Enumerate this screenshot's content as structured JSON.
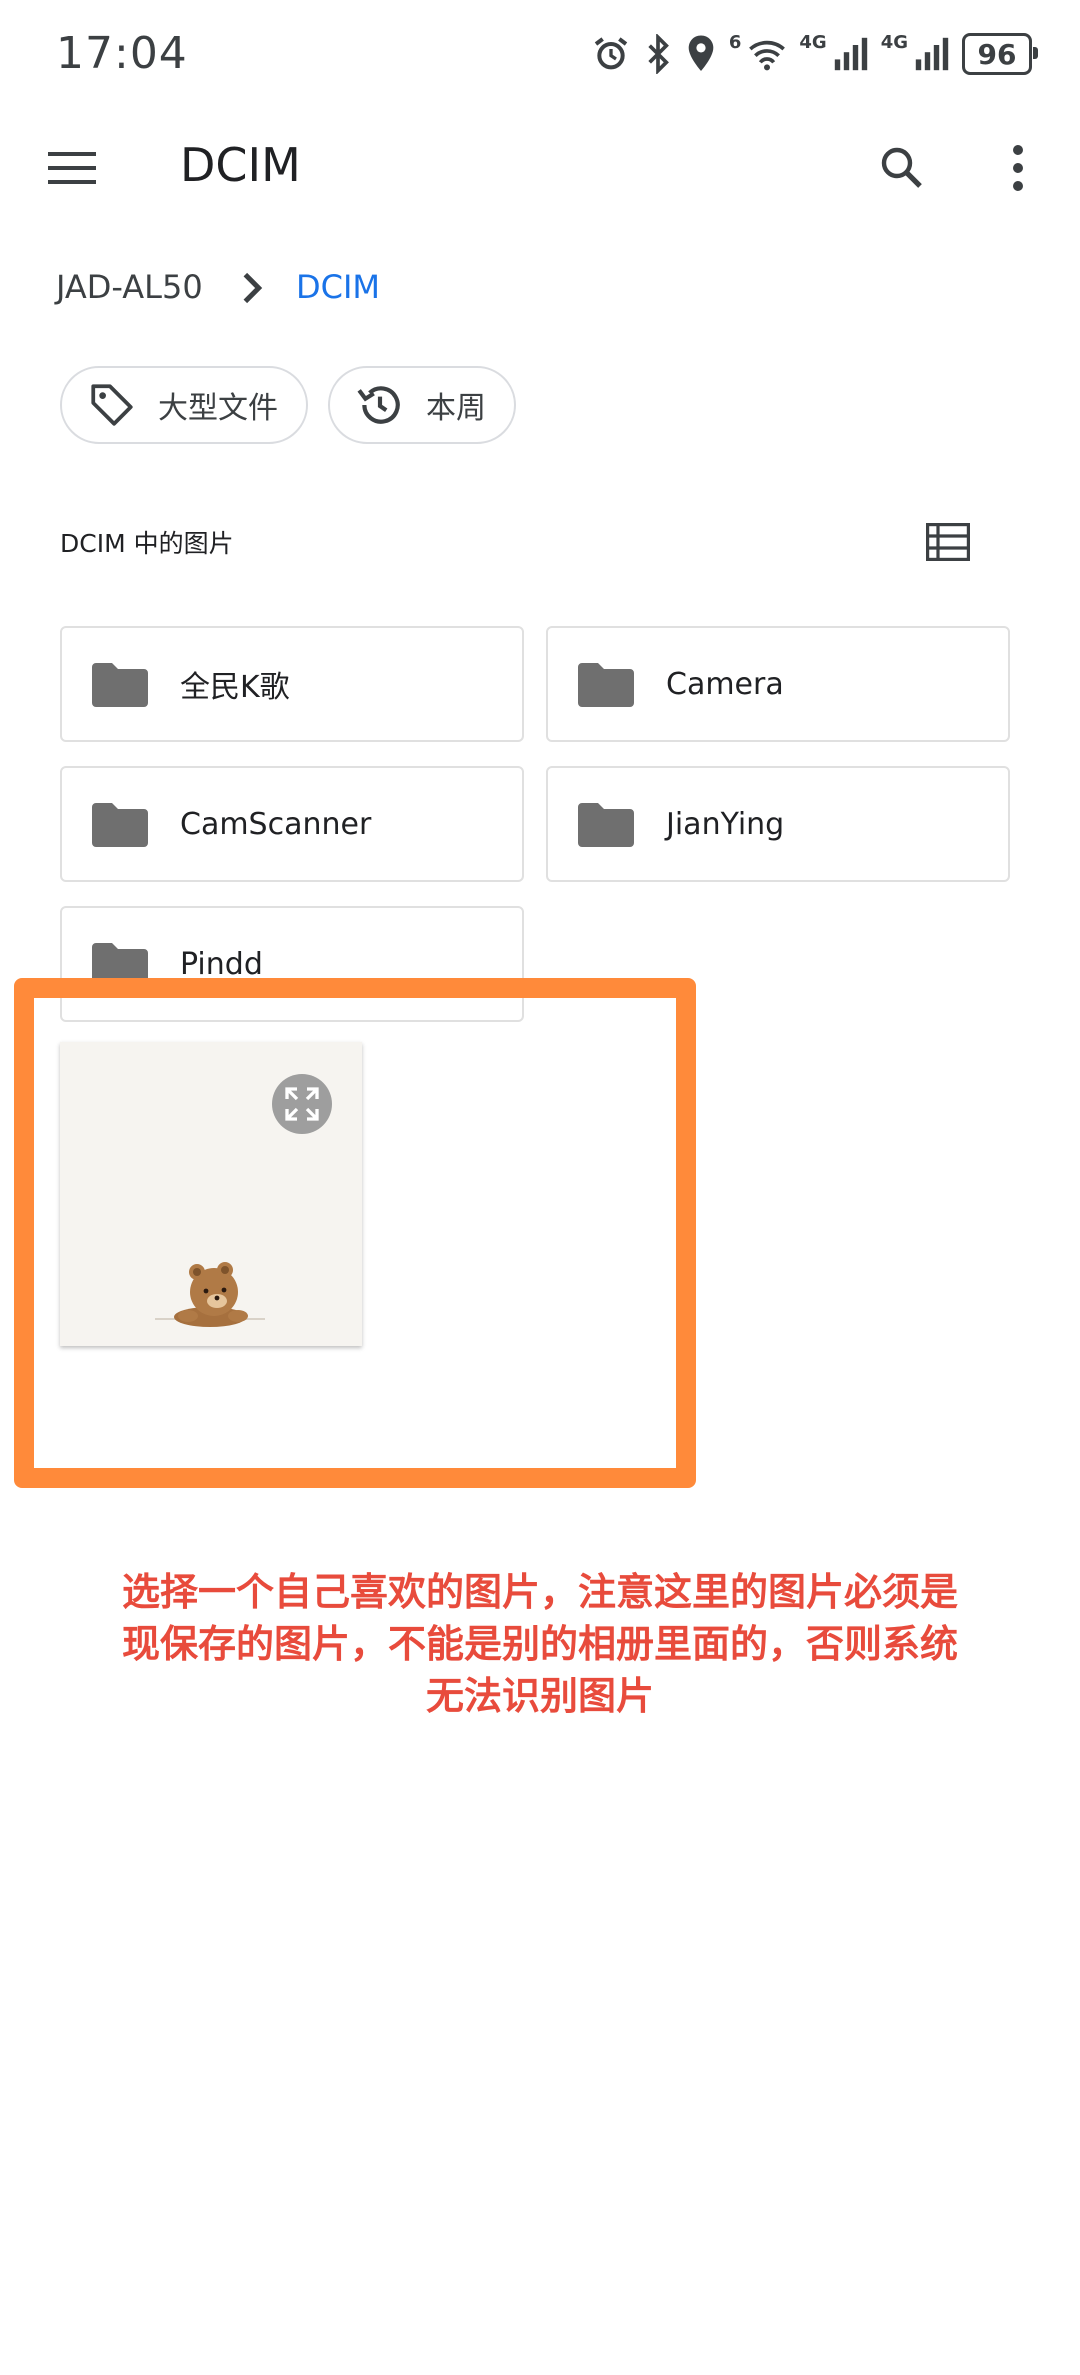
{
  "status_bar": {
    "time": "17:04",
    "network_1": "4G",
    "network_2": "4G",
    "wifi_badge": "6",
    "battery": "96",
    "icons": [
      "alarm-icon",
      "bluetooth-icon",
      "location-icon",
      "wifi-icon",
      "signal-icon",
      "signal-icon",
      "battery-icon"
    ]
  },
  "app_bar": {
    "title": "DCIM",
    "icons": [
      "menu-icon",
      "search-icon",
      "more-vert-icon"
    ]
  },
  "breadcrumb": {
    "root": "JAD-AL50",
    "current": "DCIM"
  },
  "chips": [
    {
      "label": "大型文件",
      "icon": "tag-icon"
    },
    {
      "label": "本周",
      "icon": "history-icon"
    }
  ],
  "section": {
    "title": "DCIM 中的图片",
    "view_toggle_icon": "list-view-icon"
  },
  "folders": [
    {
      "name": "全民K歌"
    },
    {
      "name": "Camera"
    },
    {
      "name": "CamScanner"
    },
    {
      "name": "JianYing"
    },
    {
      "name": "Pindd"
    }
  ],
  "thumbnail": {
    "icon": "expand-icon"
  },
  "colors": {
    "accent": "#1a73e8",
    "highlight": "#ff8a3a",
    "annotation": "#e84b3c",
    "folder": "#6f6f6f"
  },
  "annotation": {
    "text": "选择一个自己喜欢的图片，注意这里的图片必须是\n现保存的图片，不能是别的相册里面的，否则系统\n无法识别图片"
  }
}
